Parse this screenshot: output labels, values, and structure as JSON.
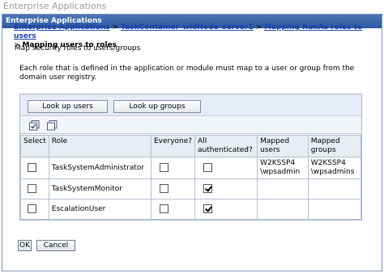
{
  "window": {
    "title": "Enterprise Applications"
  },
  "panel": {
    "header": "Enterprise Applications"
  },
  "breadcrumb": {
    "items": [
      "Enterprise Applications",
      "TaskContainer_widNode_server1",
      "Mapping RunAs roles to users"
    ],
    "separator": ">",
    "current": "Mapping users to roles"
  },
  "intro": "Map security roles to users/groups",
  "description": "Each role that is defined in the application or module must map to a user or group from the domain user registry.",
  "buttons": {
    "lookup_users": "Look up users",
    "lookup_groups": "Look up groups",
    "ok": "OK",
    "cancel": "Cancel"
  },
  "toolbar_icons": [
    "select-all-icon",
    "deselect-all-icon"
  ],
  "table": {
    "headers": {
      "select": "Select",
      "role": "Role",
      "everyone": "Everyone?",
      "authenticated": "All authenticated?",
      "mapped_users": "Mapped users",
      "mapped_groups": "Mapped groups"
    },
    "rows": [
      {
        "role": "TaskSystemAdministrator",
        "select": false,
        "everyone": false,
        "authenticated": false,
        "users": [
          "W2KSSP4",
          "\\wpsadmin"
        ],
        "groups": [
          "W2KSSP4",
          "\\wpsadmins"
        ]
      },
      {
        "role": "TaskSystemMonitor",
        "select": false,
        "everyone": false,
        "authenticated": true,
        "users": [],
        "groups": []
      },
      {
        "role": "EscalationUser",
        "select": false,
        "everyone": false,
        "authenticated": true,
        "users": [],
        "groups": []
      }
    ]
  },
  "colors": {
    "header_bg": "#2c5aa0",
    "link": "#1a3fa8",
    "table_header_bg": "#e8ecf3"
  }
}
